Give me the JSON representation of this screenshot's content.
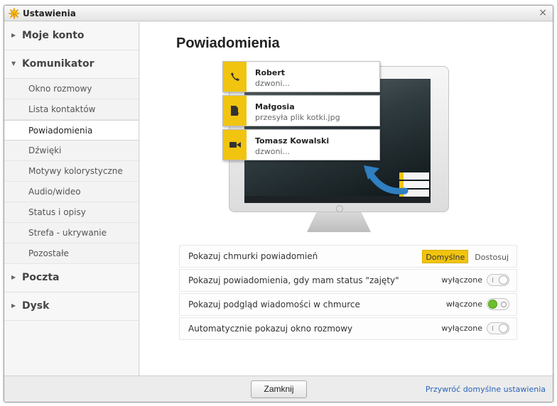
{
  "window": {
    "title": "Ustawienia",
    "close_glyph": "×",
    "app_icon": "sun-icon",
    "accent": "#f1c40f"
  },
  "sidebar": {
    "sections": [
      {
        "label": "Moje konto",
        "expanded": false
      },
      {
        "label": "Komunikator",
        "expanded": true,
        "items": [
          "Okno rozmowy",
          "Lista kontaktów",
          "Powiadomienia",
          "Dźwięki",
          "Motywy kolorystyczne",
          "Audio/wideo",
          "Status i opisy",
          "Strefa - ukrywanie",
          "Pozostałe"
        ],
        "active_item": "Powiadomienia"
      },
      {
        "label": "Poczta",
        "expanded": false
      },
      {
        "label": "Dysk",
        "expanded": false
      }
    ]
  },
  "main": {
    "title": "Powiadomienia",
    "preview_notifications": [
      {
        "icon": "phone-icon",
        "name": "Robert",
        "message": "dzwoni..."
      },
      {
        "icon": "file-download-icon",
        "name": "Małgosia",
        "message": "przesyła plik kotki.jpg"
      },
      {
        "icon": "video-camera-icon",
        "name": "Tomasz Kowalski",
        "message": "dzwoni..."
      }
    ],
    "settings": [
      {
        "label": "Pokazuj chmurki powiadomień",
        "type": "segmented",
        "options": [
          "Domyślne",
          "Dostosuj"
        ],
        "selected": "Domyślne"
      },
      {
        "label": "Pokazuj powiadomienia, gdy mam status \"zajęty\"",
        "type": "toggle",
        "state": "wyłączone",
        "on": false
      },
      {
        "label": "Pokazuj podgląd wiadomości w chmurce",
        "type": "toggle",
        "state": "włączone",
        "on": true
      },
      {
        "label": "Automatycznie pokazuj okno rozmowy",
        "type": "toggle",
        "state": "wyłączone",
        "on": false
      }
    ]
  },
  "footer": {
    "close_label": "Zamknij",
    "restore_label": "Przywróć domyślne ustawienia"
  }
}
